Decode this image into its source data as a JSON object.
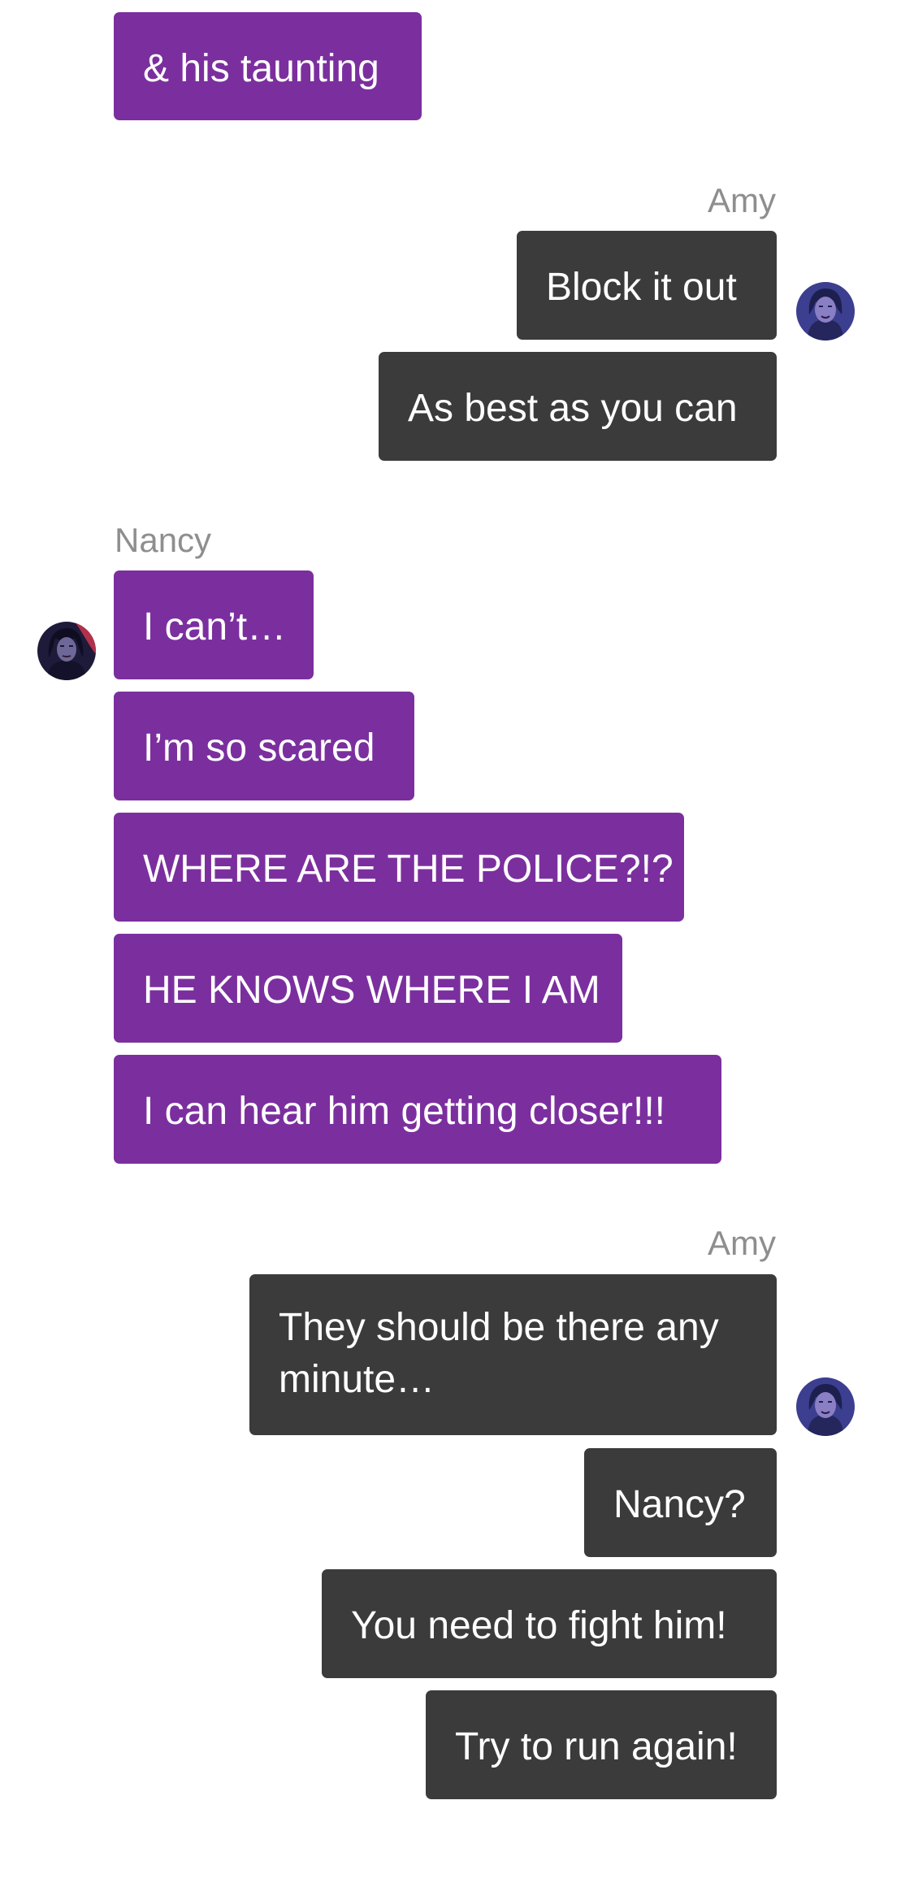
{
  "conversation": {
    "block1": {
      "messages": [
        "& his taunting"
      ]
    },
    "block2": {
      "sender": "Amy",
      "messages": [
        "Block it out",
        "As best as you can"
      ]
    },
    "block3": {
      "sender": "Nancy",
      "messages": [
        "I can’t…",
        "I’m so scared",
        "WHERE ARE THE POLICE?!?",
        "HE KNOWS WHERE I AM",
        "I can hear him getting closer!!!"
      ]
    },
    "block4": {
      "sender": "Amy",
      "messages": [
        "They should be there any minute…",
        "Nancy?",
        "You need to fight him!",
        "Try to run again!"
      ]
    }
  },
  "avatars": {
    "amy": "amy-avatar-icon",
    "nancy": "nancy-avatar-icon"
  },
  "colors": {
    "nancy_bubble": "#7b2f9e",
    "amy_bubble": "#3b3b3b",
    "sender_label": "#8e8e8e"
  }
}
